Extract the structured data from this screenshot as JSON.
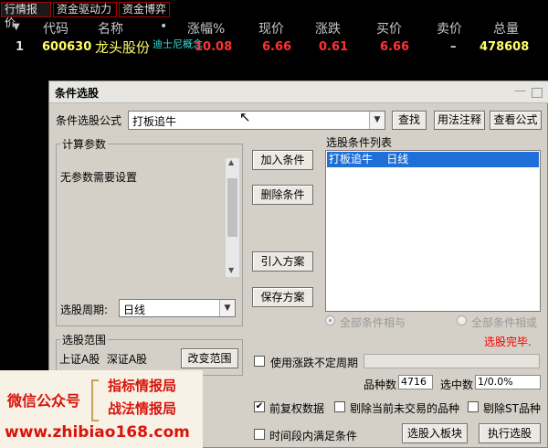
{
  "tabs": [
    "行情报价",
    "资金驱动力",
    "资金博弈"
  ],
  "columns": {
    "sort_arrow": "▼",
    "code": "代码",
    "name": "名称",
    "dot": "•",
    "change_pct": "涨幅%",
    "price": "现价",
    "change": "涨跌",
    "bid": "买价",
    "ask": "卖价",
    "volume": "总量"
  },
  "row": {
    "index": "1",
    "code": "600630",
    "name": "龙头股份",
    "concept": "迪士尼概念",
    "change_pct": "10.08",
    "price": "6.66",
    "change": "0.61",
    "bid": "6.66",
    "ask": "–",
    "volume": "478608"
  },
  "dialog": {
    "title": "条件选股",
    "formula_label": "条件选股公式",
    "formula_value": "打板追牛",
    "btn_find": "查找",
    "btn_usage": "用法注释",
    "btn_view": "查看公式",
    "params_group": "计算参数",
    "params_text": "无参数需要设置",
    "period_label": "选股周期:",
    "period_value": "日线",
    "btn_add": "加入条件",
    "btn_delete": "删除条件",
    "btn_import": "引入方案",
    "btn_save": "保存方案",
    "list_label": "选股条件列表",
    "list_items": [
      "打板追牛    日线"
    ],
    "radio_and": "全部条件相与",
    "radio_or": "全部条件相或",
    "status": "选股完毕.",
    "range_group": "选股范围",
    "range_text": "上证A股  深证A股",
    "btn_range": "改变范围",
    "use_period_label": "使用涨跌不定周期",
    "count_label": "品种数",
    "count_value": "4716",
    "selected_label": "选中数",
    "selected_value": "1/0.0%",
    "chk_adjust": "前复权数据",
    "chk_exclude_untraded": "剔除当前未交易的品种",
    "chk_exclude_st": "剔除ST品种",
    "chk_period_meet": "时间段内满足条件",
    "btn_to_board": "选股入板块",
    "btn_execute": "执行选股"
  },
  "watermark": {
    "wechat": "微信公众号",
    "tag1": "指标情报局",
    "tag2": "战法情报局",
    "url": "www.zhibiao168.com"
  },
  "colors": {
    "red": "#ff3333",
    "yellow": "#ffff66",
    "cyan": "#33dddd",
    "select": "#1f6fd8"
  }
}
